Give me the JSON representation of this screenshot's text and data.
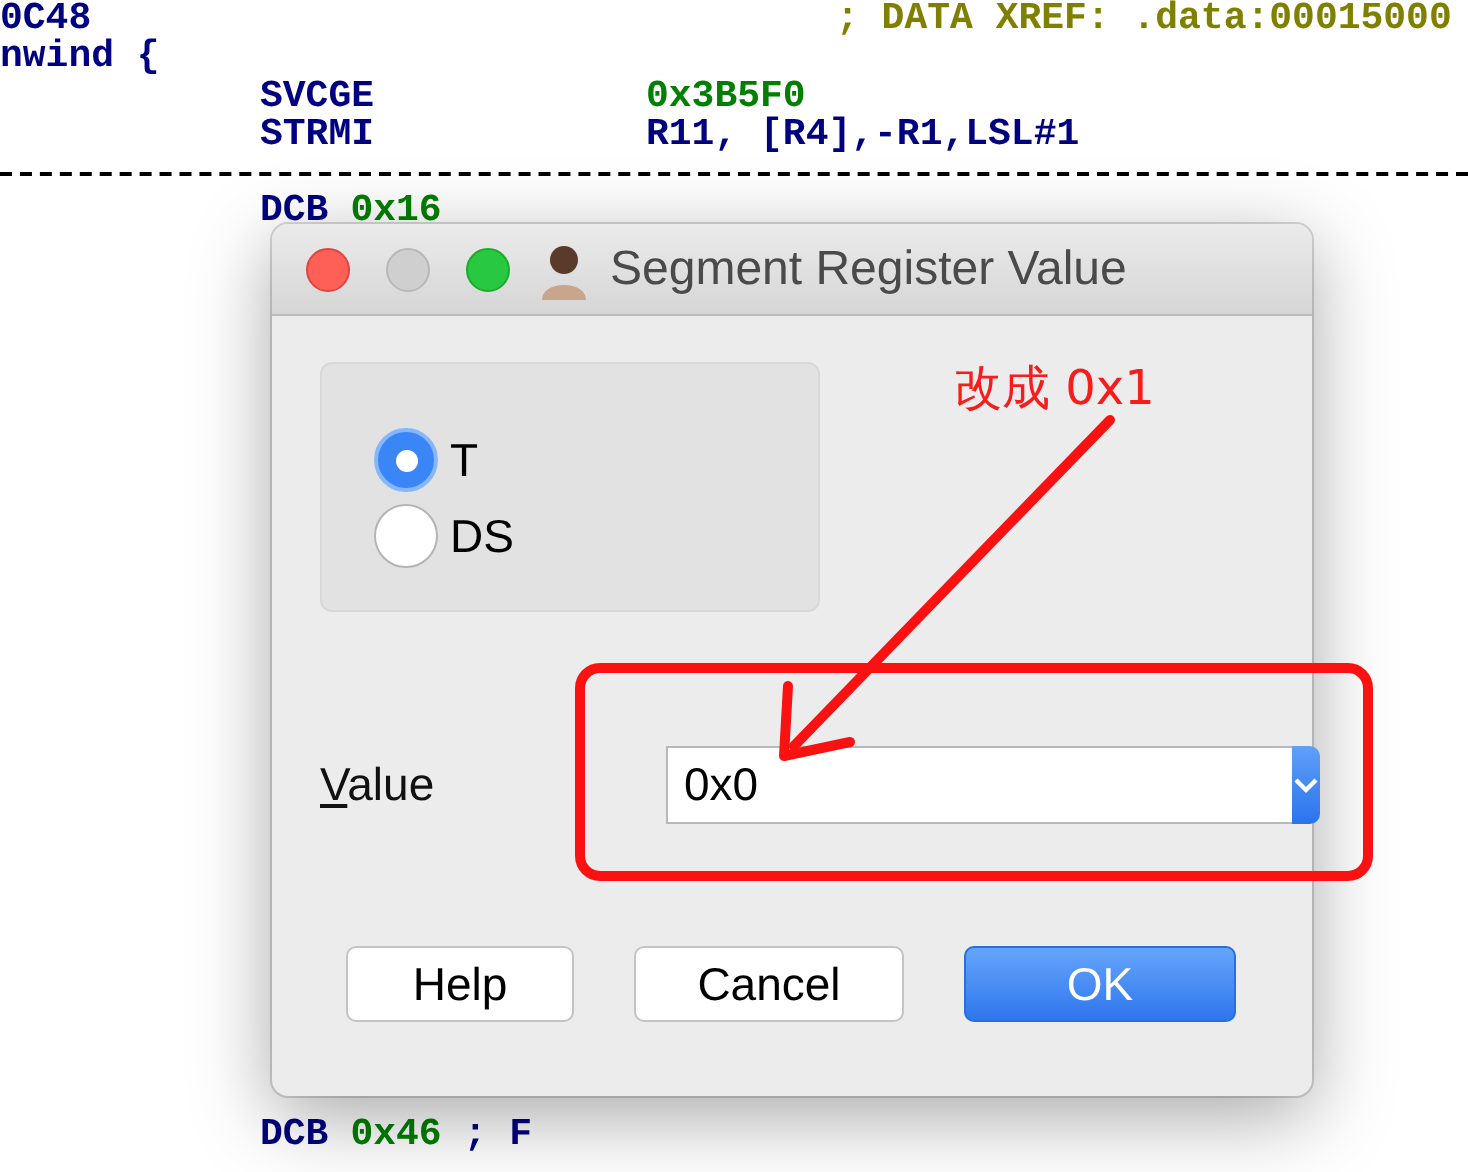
{
  "listing": [
    {
      "kind": "label",
      "label": "0C48",
      "comment": {
        "text": "; DATA XREF: .data:00015000",
        "kind": "xref"
      }
    },
    {
      "kind": "label",
      "label": "nwind {"
    },
    {
      "kind": "code",
      "mnemonic": "SVCGE",
      "operand": {
        "text": "0x3B5F0",
        "kind": "number"
      }
    },
    {
      "kind": "code",
      "mnemonic": "STRMI",
      "operand": {
        "text": "R11, [R4],-R1,LSL#1",
        "kind": "symbol"
      }
    },
    {
      "kind": "separator"
    },
    {
      "kind": "data",
      "mnemonic": "DCB",
      "operand": {
        "text": "0x16",
        "kind": "number"
      }
    }
  ],
  "listing_bottom": [
    {
      "kind": "data",
      "mnemonic": "DCB",
      "operand": {
        "text": "0x46",
        "kind": "number"
      },
      "comment": {
        "text": "; F"
      }
    }
  ],
  "dialog": {
    "title": "Segment Register Value",
    "radios": [
      {
        "label": "T",
        "selected": true
      },
      {
        "label": "DS",
        "selected": false
      }
    ],
    "value_label": "Value",
    "value_field": {
      "value": "0x0"
    },
    "buttons": [
      {
        "label": "Help",
        "kind": "normal"
      },
      {
        "label": "Cancel",
        "kind": "normal"
      },
      {
        "label": "OK",
        "kind": "default"
      }
    ]
  },
  "annotation": {
    "text": "改成 0x1"
  }
}
